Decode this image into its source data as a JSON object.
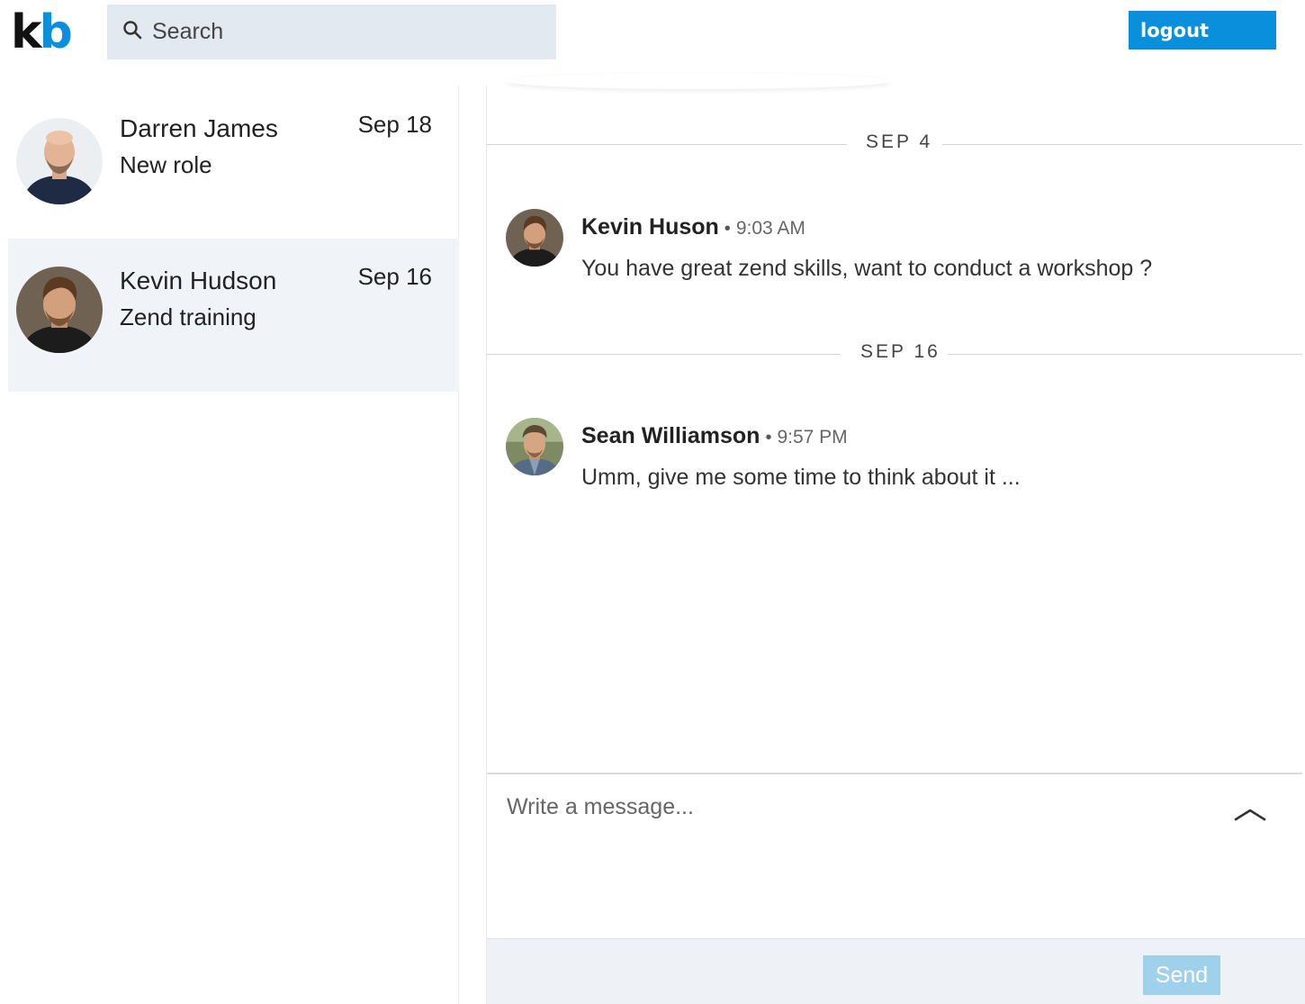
{
  "app": {
    "logo_k": "k",
    "logo_b": "b",
    "brand_color": "#0a8fdc"
  },
  "search": {
    "placeholder": "Search",
    "value": ""
  },
  "header": {
    "logout_label": "logout"
  },
  "conversations": [
    {
      "name": "Darren James",
      "snippet": "New role",
      "date": "Sep 18",
      "selected": false
    },
    {
      "name": "Kevin Hudson",
      "snippet": "Zend training",
      "date": "Sep 16",
      "selected": true
    }
  ],
  "chat": {
    "dividers": [
      {
        "label": "SEP 4"
      },
      {
        "label": "SEP 16"
      }
    ],
    "messages": [
      {
        "sender": "Kevin Huson",
        "separator": "•",
        "time": "9:03 AM",
        "text": "You have great zend skills, want to conduct a workshop ?"
      },
      {
        "sender": "Sean Williamson",
        "separator": "•",
        "time": "9:57 PM",
        "text": "Umm, give me some time to think about it ..."
      }
    ],
    "compose": {
      "placeholder": "Write a message...",
      "value": ""
    },
    "send_label": "Send"
  }
}
